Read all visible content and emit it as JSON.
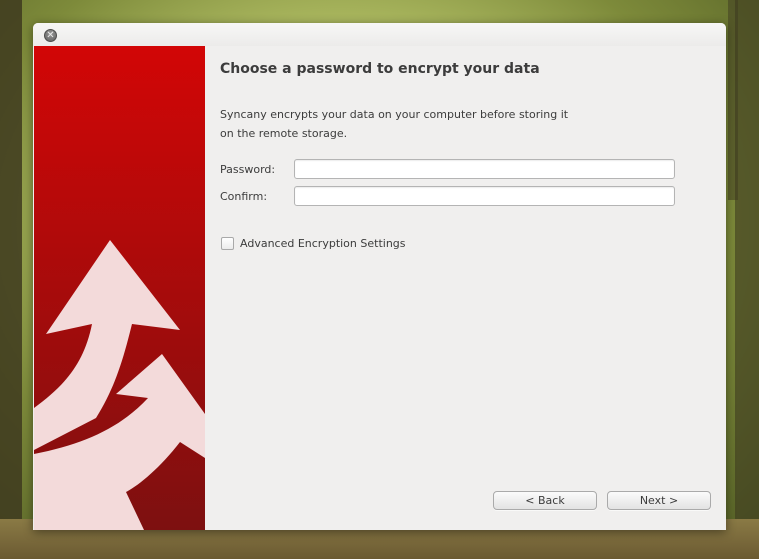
{
  "window": {
    "close_glyph": "✕"
  },
  "wizard": {
    "heading": "Choose a password to encrypt your data",
    "description_lines": [
      "Syncany encrypts your data on your computer before storing it",
      "on the remote storage."
    ],
    "password_label": "Password:",
    "password_value": "",
    "confirm_label": "Confirm:",
    "confirm_value": "",
    "advanced_label": "Advanced Encryption Settings",
    "advanced_checked": false,
    "back_label": "< Back",
    "next_label": "Next >"
  },
  "colors": {
    "banner_top": "#d20606",
    "banner_bottom": "#7d1010",
    "arrow": "#f3dada"
  },
  "icons": {
    "close": "close-icon",
    "logo": "syncany-arrows-logo"
  }
}
